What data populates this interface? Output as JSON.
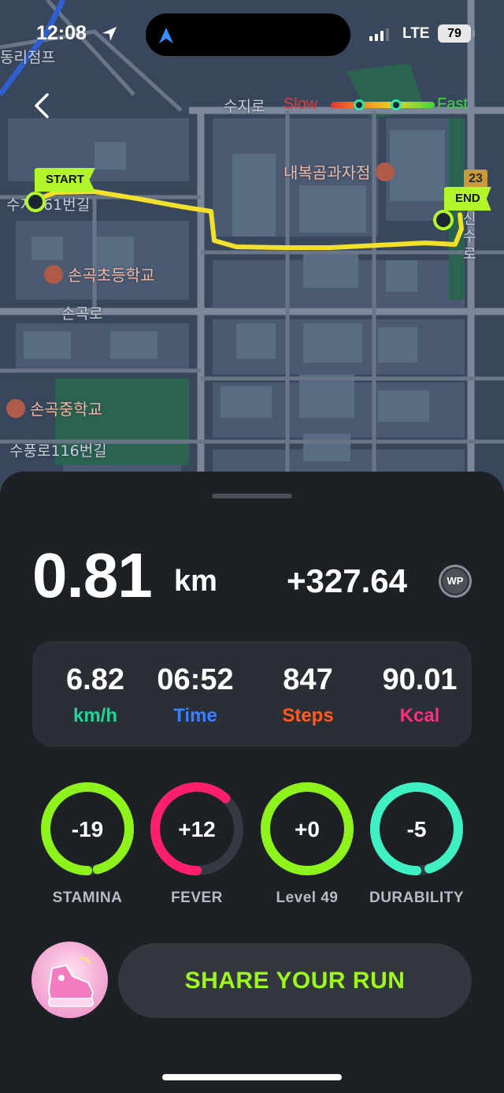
{
  "status_bar": {
    "time": "12:08",
    "network": "LTE",
    "battery": "79"
  },
  "map": {
    "labels": {
      "top_left": "동리점프",
      "road_suji": "수지로",
      "poi_store": "내복곰과자점",
      "road_number": "수지461번길",
      "poi_elem_school": "손곡초등학교",
      "road_songok": "손곡로",
      "poi_mid_school": "손곡중학교",
      "road_supung": "수풍로116번길",
      "road_badge": "23",
      "vertical_road": "신수로"
    },
    "legend": {
      "slow": "Slow",
      "fast": "Fast"
    },
    "route": {
      "start_label": "START",
      "end_label": "END",
      "color": "#f2e02a"
    }
  },
  "summary": {
    "distance_value": "0.81",
    "distance_unit": "km",
    "points_value": "+327.64",
    "points_badge": "WP"
  },
  "stats": [
    {
      "value": "6.82",
      "label": "km/h",
      "color": "#22d39a"
    },
    {
      "value": "06:52",
      "label": "Time",
      "color": "#3d7dff"
    },
    {
      "value": "847",
      "label": "Steps",
      "color": "#ff5a1f"
    },
    {
      "value": "90.01",
      "label": "Kcal",
      "color": "#ff2d7a"
    }
  ],
  "rings": [
    {
      "value": "-19",
      "label": "STAMINA",
      "color": "#8ef21b",
      "fill": 0.96
    },
    {
      "value": "+12",
      "label": "FEVER",
      "color": "#ff1f6a",
      "fill": 0.62
    },
    {
      "value": "+0",
      "label": "Level 49",
      "color": "#8ef21b",
      "fill": 1.0
    },
    {
      "value": "-5",
      "label": "DURABILITY",
      "color": "#3ef0c2",
      "fill": 0.95
    }
  ],
  "actions": {
    "share_label": "SHARE YOUR RUN"
  }
}
